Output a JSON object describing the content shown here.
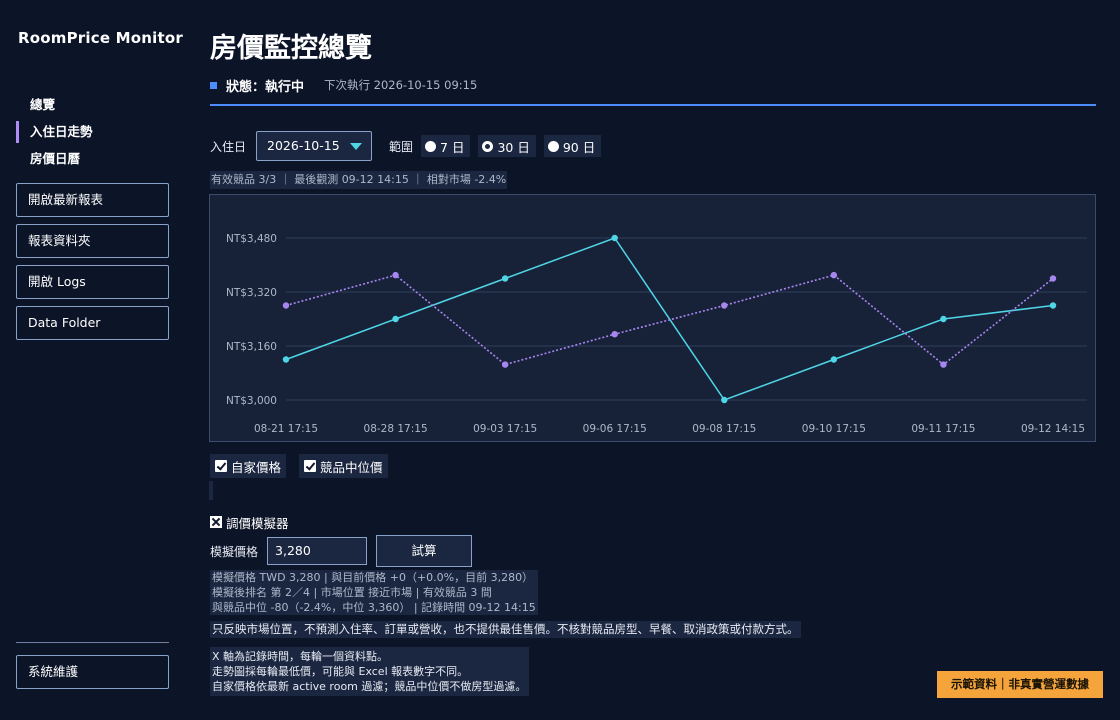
{
  "app_title": "RoomPrice Monitor",
  "sidebar": {
    "nav": [
      {
        "label": "總覽",
        "active": false
      },
      {
        "label": "入住日走勢",
        "active": true
      },
      {
        "label": "房價日曆",
        "active": false
      }
    ],
    "buttons": [
      {
        "label": "開啟最新報表"
      },
      {
        "label": "報表資料夾"
      },
      {
        "label": "開啟 Logs"
      },
      {
        "label": "Data Folder"
      }
    ],
    "maintenance_button": "系統維護"
  },
  "header": {
    "title": "房價監控總覽",
    "status": "狀態：執行中",
    "next_run": "下次執行 2026-10-15 09:15",
    "accent_color": "#4d8dff"
  },
  "controls": {
    "checkin_label": "入住日",
    "checkin_value": "2026-10-15",
    "range_label": "範圍",
    "ranges": [
      {
        "label": "7 日",
        "selected": false
      },
      {
        "label": "30 日",
        "selected": true
      },
      {
        "label": "90 日",
        "selected": false
      }
    ]
  },
  "summary": "有效競品 3/3 ｜ 最後觀測 09-12 14:15 ｜ 相對市場 -2.4%",
  "chart_data": {
    "type": "line",
    "categories": [
      "08-21 17:15",
      "08-28 17:15",
      "09-03 17:15",
      "09-06 17:15",
      "09-08 17:15",
      "09-10 17:15",
      "09-11 17:15",
      "09-12 14:15"
    ],
    "y_ticks": [
      {
        "value": 3000,
        "label": "NT$3,000"
      },
      {
        "value": 3160,
        "label": "NT$3,160"
      },
      {
        "value": 3320,
        "label": "NT$3,320"
      },
      {
        "value": 3480,
        "label": "NT$3,480"
      }
    ],
    "ylim": [
      3000,
      3480
    ],
    "grid": true,
    "series": [
      {
        "name": "自家價格",
        "color": "#4fd6e6",
        "style": "solid",
        "values": [
          3120,
          3240,
          3360,
          3480,
          3000,
          3120,
          3240,
          3280
        ]
      },
      {
        "name": "競品中位價",
        "color": "#a886f0",
        "style": "dotted",
        "values": [
          3280,
          3370,
          3105,
          3195,
          3280,
          3370,
          3105,
          3360
        ]
      }
    ]
  },
  "legend": {
    "own_price": "自家價格",
    "comp_median": "競品中位價"
  },
  "simulator": {
    "title": "調價模擬器",
    "price_label": "模擬價格",
    "price_value": "3,280",
    "calc_button": "試算",
    "result_lines": [
      "模擬價格 TWD 3,280 | 與目前價格 +0（+0.0%，目前 3,280）",
      "模擬後排名 第 2／4 | 市場位置 接近市場 | 有效競品 3 間",
      "與競品中位 -80（-2.4%，中位 3,360） | 記錄時間 09-12 14:15"
    ]
  },
  "disclaimer": "只反映市場位置，不預測入住率、訂單或營收，也不提供最佳售價。不核對競品房型、早餐、取消政策或付款方式。",
  "notes": [
    "X 軸為記錄時間，每輪一個資料點。",
    "走勢圖採每輪最低價，可能與 Excel 報表數字不同。",
    "自家價格依最新 active room 過濾；競品中位價不做房型過濾。"
  ],
  "demo_badge": "示範資料｜非真實營運數據",
  "colors": {
    "background": "#0c1428",
    "panel": "#1b2740",
    "badge": "#f5a43c"
  }
}
